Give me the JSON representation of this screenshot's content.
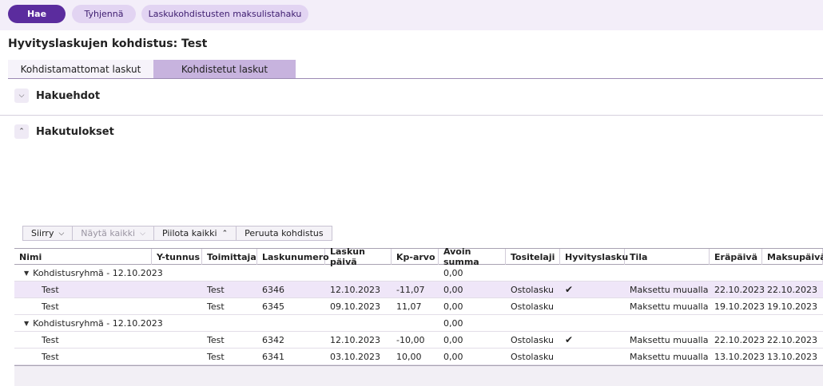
{
  "topbar": {
    "search_label": "Hae",
    "clear_label": "Tyhjennä",
    "payment_search_label": "Laskukohdistusten maksulistahaku"
  },
  "page": {
    "title": "Hyvityslaskujen kohdistus: Test"
  },
  "tabs": [
    {
      "label": "Kohdistamattomat laskut"
    },
    {
      "label": "Kohdistetut laskut"
    }
  ],
  "sections": {
    "search_criteria": "Hakuehdot",
    "results": "Hakutulokset"
  },
  "toolbar": {
    "move": "Siirry",
    "show_all": "Näytä kaikki",
    "hide_all": "Piilota kaikki",
    "cancel_allocation": "Peruuta kohdistus"
  },
  "grid": {
    "columns": [
      "Nimi",
      "Y-tunnus",
      "Toimittaja",
      "Laskunumero",
      "Laskun päivä",
      "Kp-arvo",
      "Avoin summa",
      "Tositelaji",
      "Hyvityslasku",
      "Tila",
      "Eräpäivä",
      "Maksupäivä"
    ],
    "groups": [
      {
        "label": "Kohdistusryhmä - 12.10.2023",
        "open_sum": "0,00",
        "rows": [
          {
            "name": "Test",
            "y_id": "",
            "supplier": "Test",
            "invoice_no": "6346",
            "invoice_date": "12.10.2023",
            "kp_value": "-11,07",
            "open_sum": "0,00",
            "voucher_type": "Ostolasku",
            "credit_note": "✔",
            "status": "Maksettu muualla",
            "due_date": "22.10.2023",
            "pay_date": "22.10.2023"
          },
          {
            "name": "Test",
            "y_id": "",
            "supplier": "Test",
            "invoice_no": "6345",
            "invoice_date": "09.10.2023",
            "kp_value": "11,07",
            "open_sum": "0,00",
            "voucher_type": "Ostolasku",
            "credit_note": "",
            "status": "Maksettu muualla",
            "due_date": "19.10.2023",
            "pay_date": "19.10.2023"
          }
        ]
      },
      {
        "label": "Kohdistusryhmä - 12.10.2023",
        "open_sum": "0,00",
        "rows": [
          {
            "name": "Test",
            "y_id": "",
            "supplier": "Test",
            "invoice_no": "6342",
            "invoice_date": "12.10.2023",
            "kp_value": "-10,00",
            "open_sum": "0,00",
            "voucher_type": "Ostolasku",
            "credit_note": "✔",
            "status": "Maksettu muualla",
            "due_date": "22.10.2023",
            "pay_date": "22.10.2023"
          },
          {
            "name": "Test",
            "y_id": "",
            "supplier": "Test",
            "invoice_no": "6341",
            "invoice_date": "03.10.2023",
            "kp_value": "10,00",
            "open_sum": "0,00",
            "voucher_type": "Ostolasku",
            "credit_note": "",
            "status": "Maksettu muualla",
            "due_date": "13.10.2023",
            "pay_date": "13.10.2023"
          }
        ]
      }
    ]
  },
  "colors": {
    "primary": "#5b2c9e",
    "secondary": "#e2d4f2",
    "active_tab": "#c7b3de",
    "selected_row": "#efe6f8"
  }
}
